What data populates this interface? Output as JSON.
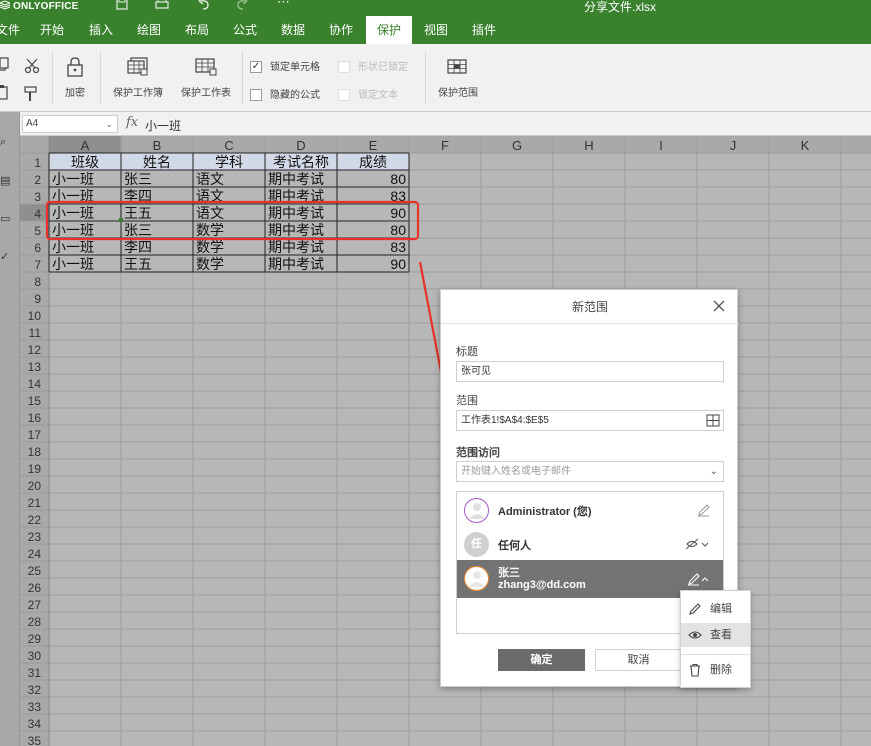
{
  "app": {
    "logo": "ONLYOFFICE",
    "document_title": "分享文件.xlsx"
  },
  "quick_access": [
    "save-icon",
    "print-icon",
    "undo-icon",
    "redo-icon",
    "more-icon"
  ],
  "menu": {
    "tabs": [
      {
        "label": "文件"
      },
      {
        "label": "开始"
      },
      {
        "label": "插入"
      },
      {
        "label": "绘图"
      },
      {
        "label": "布局"
      },
      {
        "label": "公式"
      },
      {
        "label": "数据"
      },
      {
        "label": "协作"
      },
      {
        "label": "保护",
        "active": true
      },
      {
        "label": "视图"
      },
      {
        "label": "插件"
      }
    ]
  },
  "ribbon": {
    "encrypt": "加密",
    "protect_workbook": "保护工作簿",
    "protect_sheet": "保护工作表",
    "locked_cell": "锁定单元格",
    "hidden_formula": "隐藏的公式",
    "shape_locked": "形状已锁定",
    "lock_text": "锁定文本",
    "protect_range": "保护范围"
  },
  "formula_bar": {
    "cell_ref": "A4",
    "fx": "fx",
    "content": "小一班"
  },
  "sheet": {
    "columns": [
      "A",
      "B",
      "C",
      "D",
      "E",
      "F",
      "G",
      "H",
      "I",
      "J",
      "K"
    ],
    "row_count": 35,
    "rows": [
      [
        "班级",
        "姓名",
        "学科",
        "考试名称",
        "成绩"
      ],
      [
        "小一班",
        "张三",
        "语文",
        "期中考试",
        "80"
      ],
      [
        "小一班",
        "李四",
        "语文",
        "期中考试",
        "83"
      ],
      [
        "小一班",
        "王五",
        "语文",
        "期中考试",
        "90"
      ],
      [
        "小一班",
        "张三",
        "数学",
        "期中考试",
        "80"
      ],
      [
        "小一班",
        "李四",
        "数学",
        "期中考试",
        "83"
      ],
      [
        "小一班",
        "王五",
        "数学",
        "期中考试",
        "90"
      ]
    ],
    "selected_cell": "A4",
    "highlight_rows": [
      4,
      5
    ]
  },
  "dialog": {
    "title": "新范围",
    "title_label": "标题",
    "title_value": "张可见",
    "range_label": "范围",
    "range_value": "工作表1!$A$4:$E$5",
    "access_label": "范围访问",
    "access_placeholder": "开始键入姓名或电子邮件",
    "users": [
      {
        "name": "Administrator (您)",
        "access_icon": "edit-icon"
      },
      {
        "initial": "任",
        "name": "任何人",
        "access_icon": "hidden-icon"
      },
      {
        "name": "张三",
        "email": "zhang3@dd.com",
        "access_icon": "edit-icon",
        "selected": true
      }
    ],
    "ok": "确定",
    "cancel": "取消"
  },
  "access_menu": {
    "items": [
      {
        "label": "编辑",
        "icon": "pencil-icon"
      },
      {
        "label": "查看",
        "icon": "eye-icon",
        "hovered": true
      },
      {
        "label": "删除",
        "icon": "trash-icon"
      }
    ]
  },
  "colors": {
    "brand_green": "#3a812e",
    "header_fill": "#d2d9e6",
    "annotation_red": "#e8332a",
    "selected_row": "#737373"
  }
}
